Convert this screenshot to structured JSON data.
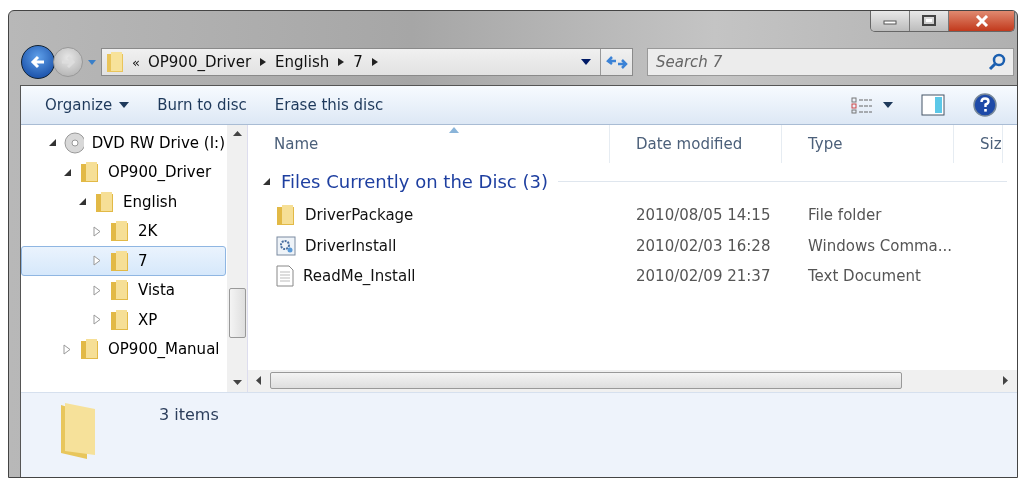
{
  "address_bar": {
    "overflow": "«",
    "crumbs": [
      "OP900_Driver",
      "English",
      "7"
    ]
  },
  "search": {
    "placeholder": "Search 7"
  },
  "toolbar": {
    "buttons": [
      {
        "label": "Organize",
        "dropdown": true
      },
      {
        "label": "Burn to disc",
        "dropdown": false
      },
      {
        "label": "Erase this disc",
        "dropdown": false
      }
    ]
  },
  "tree": [
    {
      "label": "DVD RW Drive (I:)",
      "kind": "drive",
      "expanded": true,
      "selected": false,
      "children": [
        {
          "label": "OP900_Driver",
          "kind": "folder",
          "expanded": true,
          "selected": false,
          "children": [
            {
              "label": "English",
              "kind": "folder",
              "expanded": true,
              "selected": false,
              "children": [
                {
                  "label": "2K",
                  "kind": "folder",
                  "expanded": false,
                  "selected": false
                },
                {
                  "label": "7",
                  "kind": "folder",
                  "expanded": false,
                  "selected": true
                },
                {
                  "label": "Vista",
                  "kind": "folder",
                  "expanded": false,
                  "selected": false
                },
                {
                  "label": "XP",
                  "kind": "folder",
                  "expanded": false,
                  "selected": false
                }
              ]
            }
          ]
        },
        {
          "label": "OP900_Manual",
          "kind": "folder",
          "expanded": false,
          "selected": false
        }
      ]
    }
  ],
  "table": {
    "columns": [
      "Name",
      "Date modified",
      "Type",
      "Siz"
    ],
    "group": {
      "label": "Files Currently on the Disc (3)",
      "expanded": true
    },
    "rows": [
      {
        "name": "DriverPackage",
        "kind": "folder",
        "date": "2010/08/05 14:15",
        "type": "File folder"
      },
      {
        "name": "DriverInstall",
        "kind": "command",
        "date": "2010/02/03 16:28",
        "type": "Windows Comma..."
      },
      {
        "name": "ReadMe_Install",
        "kind": "text",
        "date": "2010/02/09 21:37",
        "type": "Text Document"
      }
    ]
  },
  "status_bar": {
    "text": "3 items"
  }
}
